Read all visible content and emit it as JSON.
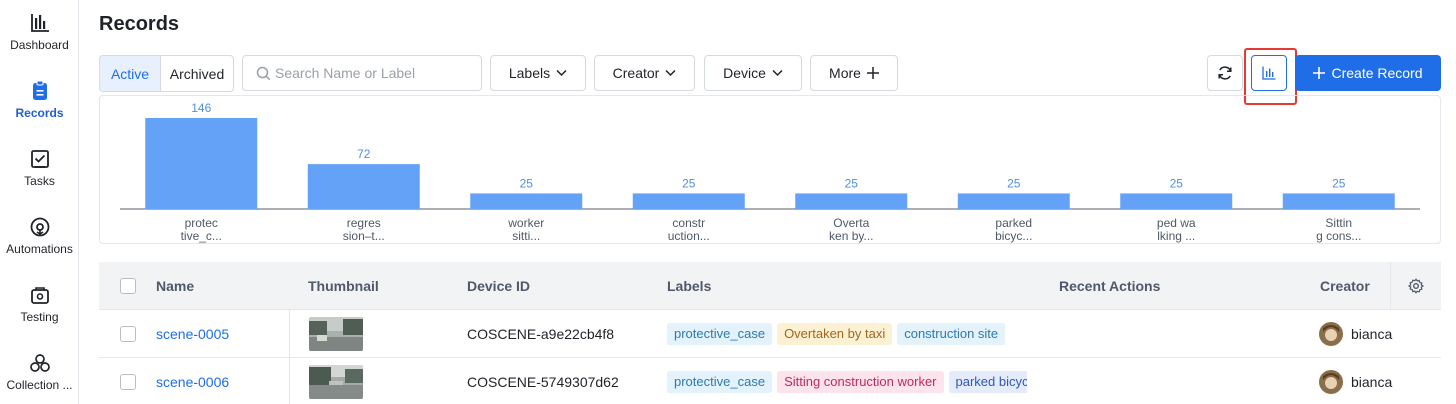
{
  "sidebar": {
    "items": [
      {
        "label": "Dashboard",
        "icon": "bar-chart-icon",
        "active": false
      },
      {
        "label": "Records",
        "icon": "clipboard-icon",
        "active": true
      },
      {
        "label": "Tasks",
        "icon": "task-check-icon",
        "active": false
      },
      {
        "label": "Automations",
        "icon": "automation-icon",
        "active": false
      },
      {
        "label": "Testing",
        "icon": "testing-icon",
        "active": false
      },
      {
        "label": "Collection ...",
        "icon": "collection-icon",
        "active": false
      }
    ]
  },
  "page": {
    "title": "Records"
  },
  "toolbar": {
    "tabs": [
      "Active",
      "Archived"
    ],
    "active_tab": "Active",
    "search_placeholder": "Search Name or Label",
    "search_value": "",
    "filters": [
      "Labels",
      "Creator",
      "Device"
    ],
    "more_label": "More",
    "create_label": "Create Record"
  },
  "chart_data": {
    "type": "bar",
    "categories": [
      [
        "protec",
        "tive_c..."
      ],
      [
        "regres",
        "sion–t..."
      ],
      [
        "worker",
        "sitti..."
      ],
      [
        "constr",
        "uction..."
      ],
      [
        "Overta",
        "ken by..."
      ],
      [
        "parked",
        "bicyc..."
      ],
      [
        "ped wa",
        "lking ..."
      ],
      [
        "Sittin",
        "g cons..."
      ]
    ],
    "values": [
      146,
      72,
      25,
      25,
      25,
      25,
      25,
      25
    ],
    "ylim": [
      0,
      146
    ],
    "grid": false,
    "bar_color": "#63a2f7",
    "label_color": "#4f8fe6"
  },
  "table": {
    "columns": [
      "Name",
      "Thumbnail",
      "Device ID",
      "Labels",
      "Recent Actions",
      "Creator"
    ],
    "rows": [
      {
        "name": "scene-0005",
        "device_id": "COSCENE-a9e22cb4f8",
        "labels": [
          {
            "text": "protective_case",
            "color": "#e3f2fb",
            "text_color": "#2b7bb0"
          },
          {
            "text": "Overtaken by taxi",
            "color": "#fdf1d4",
            "text_color": "#a4651b"
          },
          {
            "text": "construction site",
            "color": "#e3f2fb",
            "text_color": "#2b7bb0"
          }
        ],
        "recent_actions": "",
        "creator": "bianca"
      },
      {
        "name": "scene-0006",
        "device_id": "COSCENE-5749307d62",
        "labels": [
          {
            "text": "protective_case",
            "color": "#e3f2fb",
            "text_color": "#2b7bb0"
          },
          {
            "text": "Sitting construction worker",
            "color": "#fde4ec",
            "text_color": "#c2285e"
          },
          {
            "text": "parked bicycl",
            "color": "#e4ebfc",
            "text_color": "#2e58b8"
          }
        ],
        "recent_actions": "",
        "creator": "bianca"
      }
    ]
  },
  "colors": {
    "accent": "#1f6ee8",
    "highlight": "#e53935",
    "header_bg": "#f2f3f5"
  }
}
